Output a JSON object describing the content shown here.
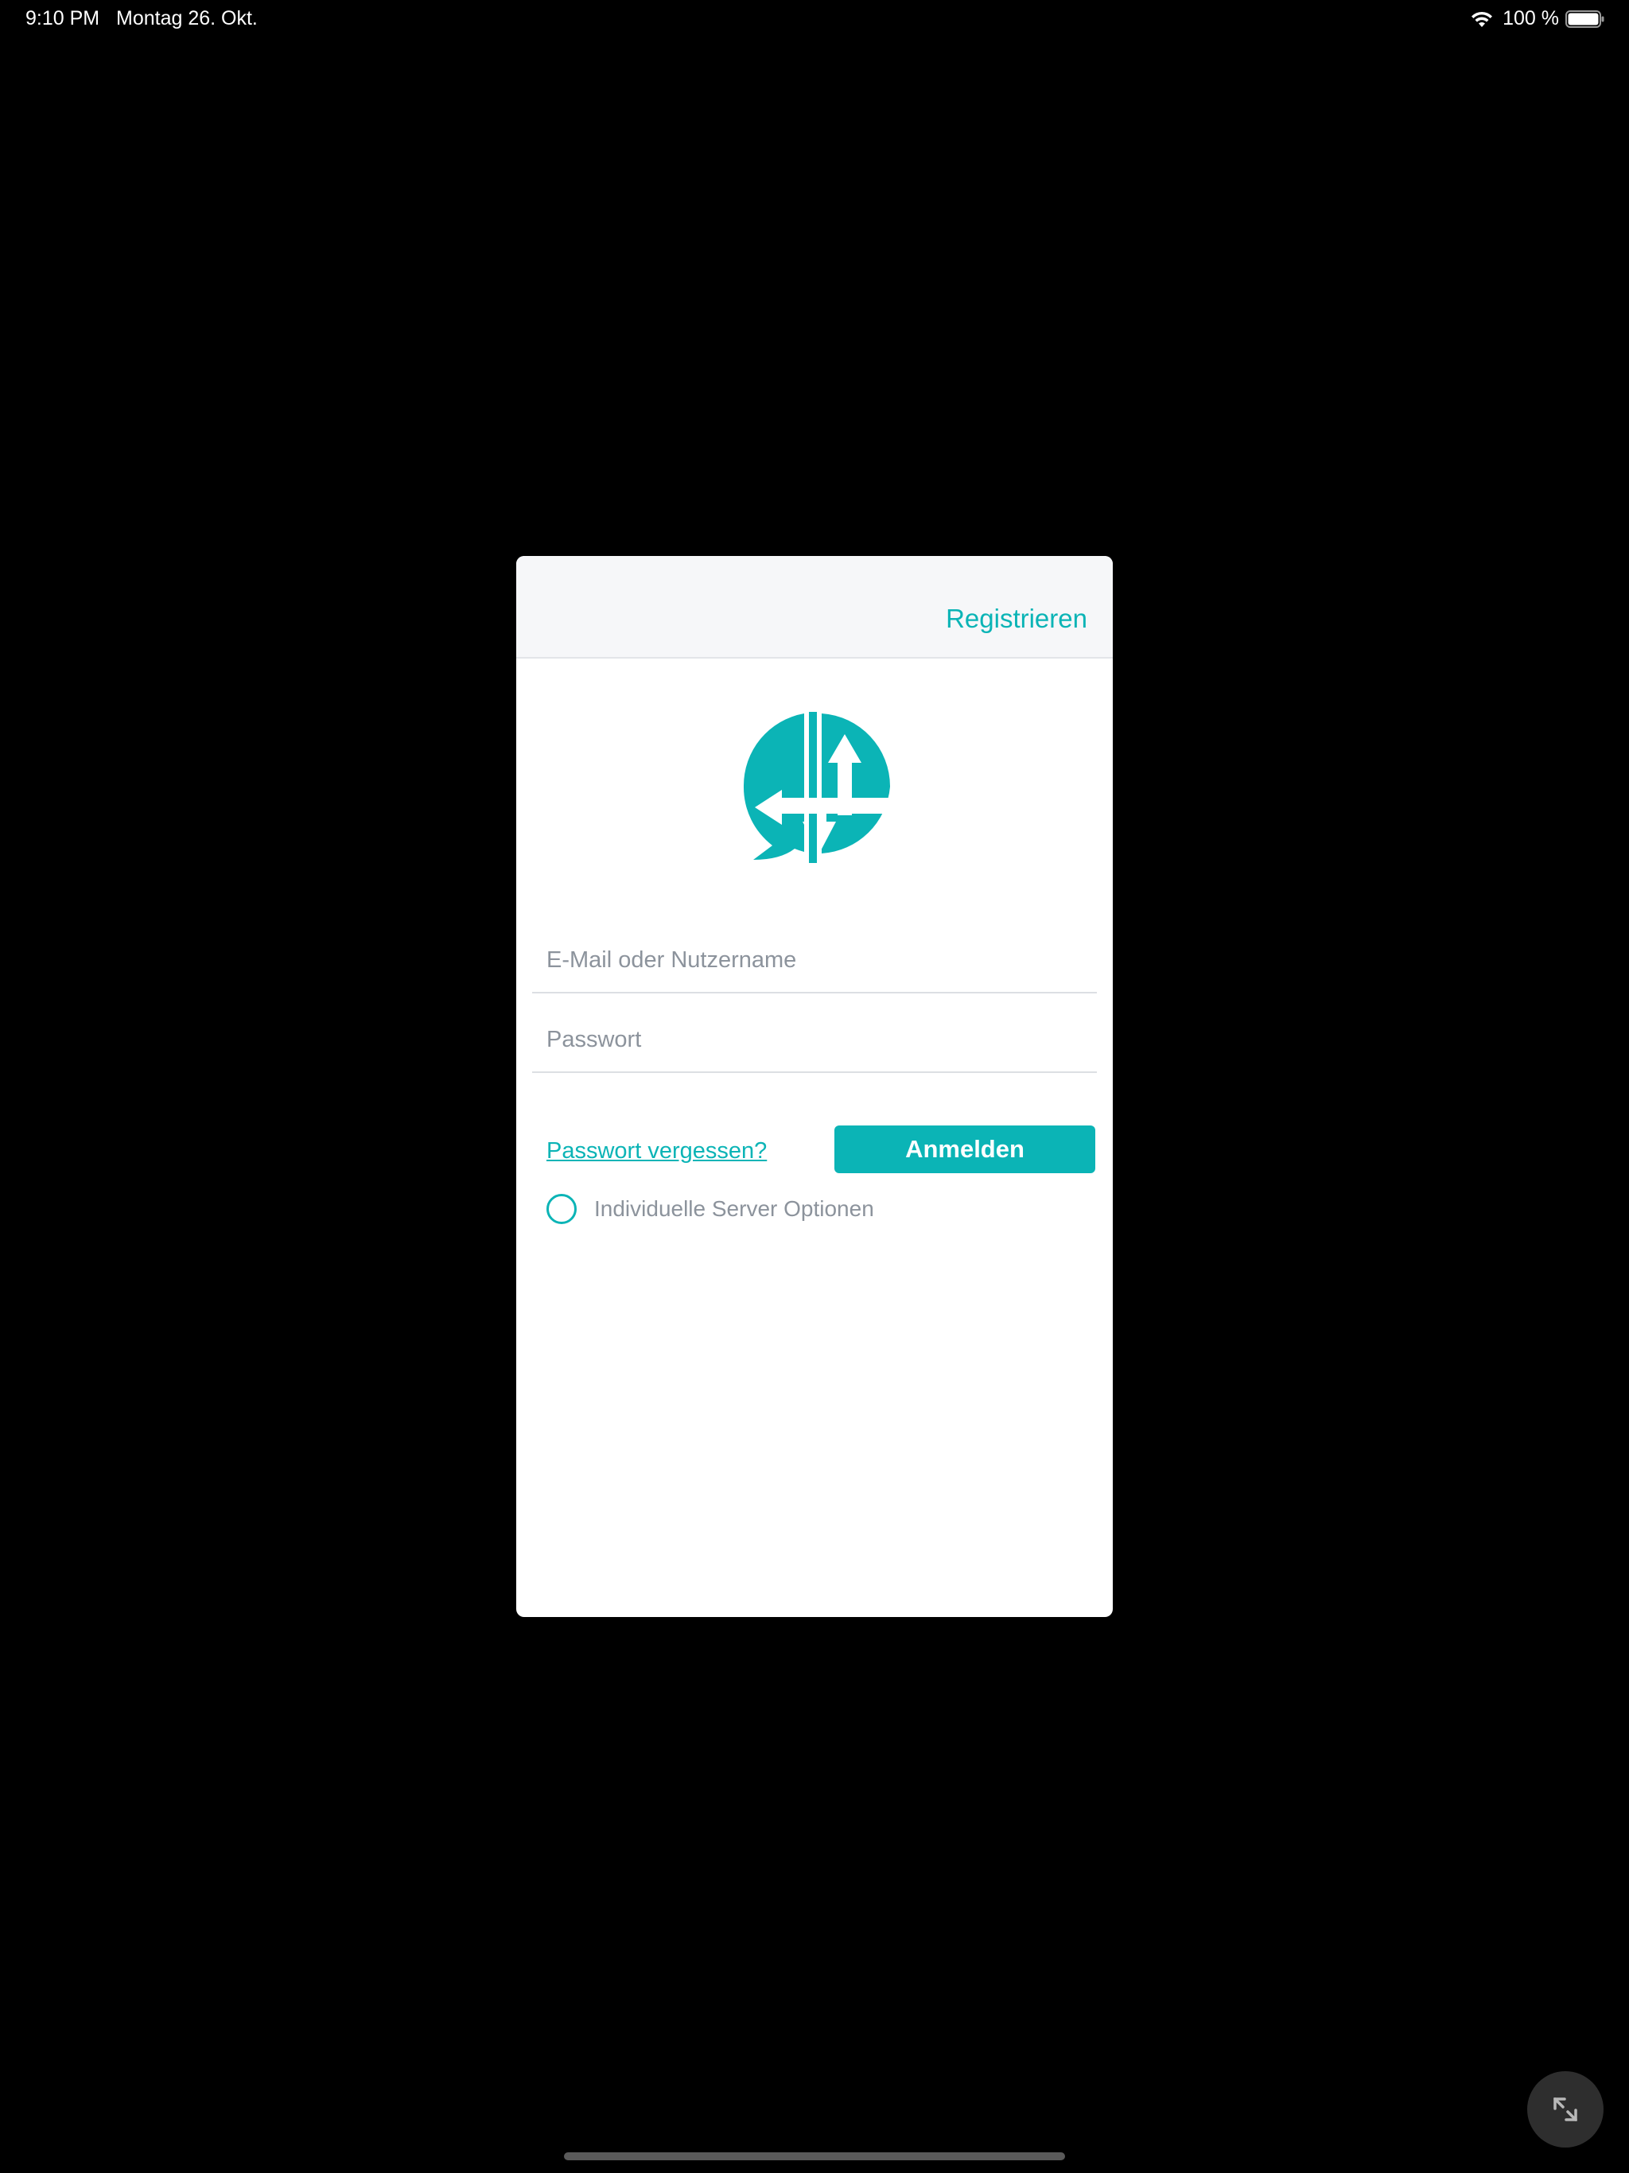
{
  "status_bar": {
    "time": "9:10 PM",
    "date": "Montag 26. Okt.",
    "battery": "100 %"
  },
  "modal": {
    "register_label": "Registrieren",
    "email_placeholder": "E-Mail oder Nutzername",
    "password_placeholder": "Passwort",
    "forgot_label": "Passwort vergessen?",
    "login_label": "Anmelden",
    "server_options_label": "Individuelle Server Optionen"
  },
  "colors": {
    "accent": "#0bb4b6",
    "background": "#000000",
    "header_bg": "#f6f7f9"
  },
  "icons": {
    "wifi": "wifi-icon",
    "battery": "battery-icon",
    "logo": "app-logo-icon",
    "expand": "expand-arrows-icon"
  }
}
